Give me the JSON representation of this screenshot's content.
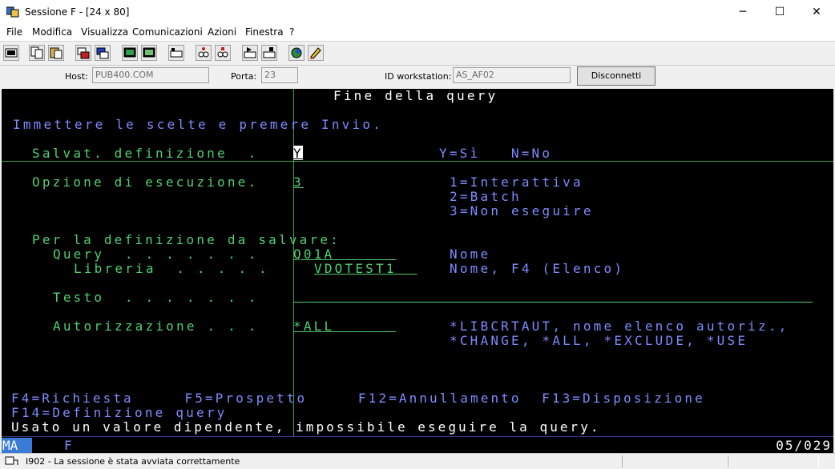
{
  "window": {
    "title": "Sessione F - [24 x 80]",
    "minimize": "─",
    "maximize": "☐",
    "close": "✕"
  },
  "menu": [
    "File",
    "Modifica",
    "Visualizza",
    "Comunicazioni",
    "Azioni",
    "Finestra",
    "?"
  ],
  "toolbar": {
    "icons": [
      "print-screen-icon",
      "copy-icon",
      "paste-icon",
      "send-file-icon",
      "receive-file-icon",
      "display-settings-icon",
      "keyboard-map-icon",
      "macro-record-icon",
      "macro-play-icon",
      "macro-stop-icon",
      "macro-run-icon",
      "macro-edit-icon",
      "help-icon",
      "marker-icon"
    ]
  },
  "hostbar": {
    "host_label": "Host:",
    "host_value": "PUB400.COM",
    "port_label": "Porta:",
    "port_value": "23",
    "workstation_label": "ID workstation:",
    "workstation_value": "AS_AF02",
    "disconnect_label": "Disconnetti"
  },
  "screen": {
    "title": "Fine della query",
    "instructions": "Immettere le scelte e premere Invio.",
    "save_label": "Salvat. definizione  .",
    "save_value": "Y",
    "save_options": "Y=Sì   N=No",
    "run_label": "Opzione di esecuzione.",
    "run_value": "3",
    "run_opt1": "1=Interattiva",
    "run_opt2": "2=Batch",
    "run_opt3": "3=Non eseguire",
    "section_label": "Per la definizione da salvare:",
    "query_label": "Query  . . . . . . .",
    "query_value": "Q01A      ",
    "query_hint": "Nome",
    "library_label": "Libreria  . . . . .",
    "library_value": "VDOTEST1  ",
    "library_hint": "Nome, F4 (Elenco)",
    "text_label": "Testo  . . . . . . .",
    "auth_label": "Autorizzazione . . .",
    "auth_value": "*ALL      ",
    "auth_hint1": "*LIBCRTAUT, nome elenco autoriz.,",
    "auth_hint2": "*CHANGE, *ALL, *EXCLUDE, *USE",
    "fkeys1": "F4=Richiesta     F5=Prospetto     F12=Annullamento  F13=Disposizione",
    "fkeys2": "F14=Definizione query",
    "message": "Usato un valore dipendente, impossibile eseguire la query."
  },
  "oia": {
    "mode": "MA",
    "session": "F",
    "cursor_pos": "05/029"
  },
  "status": {
    "message": "I902 - La sessione è stata avviata correttamente"
  },
  "colors": {
    "terminal_bg": "#000000",
    "blue_text": "#7e8cff",
    "white_text": "#ffffff",
    "green_text": "#4fd070",
    "crosshair": "#3aa34e"
  }
}
